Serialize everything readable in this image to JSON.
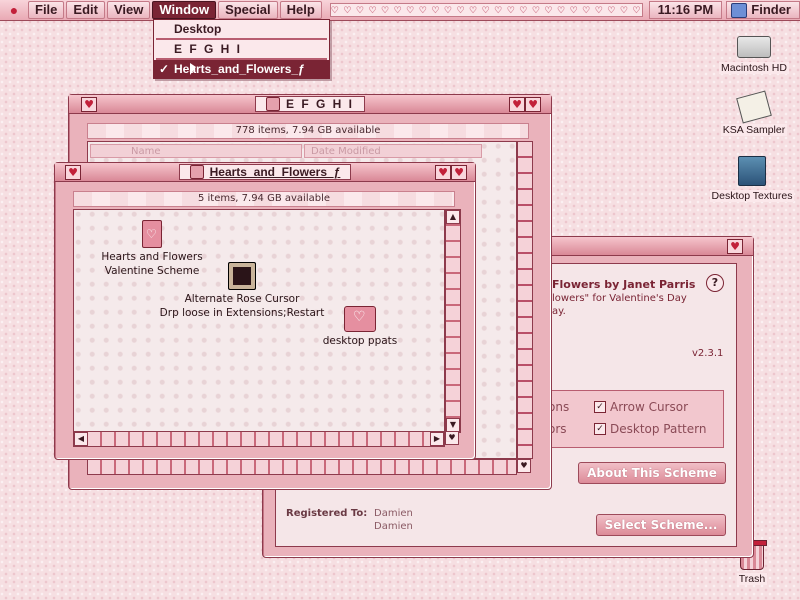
{
  "menubar": {
    "apple_icon": "apple-icon",
    "menus": [
      "File",
      "Edit",
      "View",
      "Window",
      "Special",
      "Help"
    ],
    "active_menu": "Window",
    "hearts": "♡ ♡ ♡ ♡ ♡ ♡ ♡ ♡ ♡ ♡ ♡ ♡ ♡ ♡ ♡ ♡ ♡ ♡ ♡ ♡ ♡ ♡ ♡ ♡ ♡ ♡ ♡ ♡ ♡ ♡",
    "clock": "11:16 PM",
    "app": "Finder"
  },
  "window_menu": {
    "items": [
      {
        "label": "Desktop"
      },
      {
        "label": "E F G H I"
      },
      {
        "label": "Hearts_and_Flowers_ƒ",
        "checked": true
      }
    ],
    "check_mark": "✓"
  },
  "window_efghi": {
    "title": "E F G H I",
    "info": "778 items, 7.94 GB available",
    "columns": [
      "Name",
      "Date Modified"
    ]
  },
  "window_hearts": {
    "title": "Hearts_and_Flowers_ƒ",
    "info": "5 items, 7.94 GB available",
    "icons": [
      {
        "label_line1": "Hearts and Flowers",
        "label_line2": "Valentine Scheme",
        "icon": "scheme-document-icon"
      },
      {
        "label_line1": "Alternate Rose Cursor",
        "label_line2": "Drp loose in Extensions;Restart",
        "icon": "rose-cursor-icon"
      },
      {
        "label_line1": "desktop ppats",
        "label_line2": "",
        "icon": "heart-folder-icon"
      }
    ]
  },
  "scheme_window": {
    "title_part": "Flowers by Janet Parris",
    "subtitle_part": "lowers\" for Valentine's Day",
    "subtitle_part2": "ay.",
    "version": "v2.3.1",
    "option_left1": "ons",
    "option_left2": "ors",
    "option_arrow": "Arrow Cursor",
    "option_pattern": "Desktop Pattern",
    "check_mark": "✓",
    "about_button": "About This Scheme",
    "registered_label": "Registered To:",
    "registered_name1": "Damien",
    "registered_name2": "Damien",
    "select_button": "Select Scheme...",
    "help_glyph": "?"
  },
  "desktop": {
    "icons": [
      {
        "label": "Macintosh HD",
        "icon": "hard-disk-icon"
      },
      {
        "label": "KSA Sampler",
        "icon": "ksa-sampler-icon"
      },
      {
        "label": "Desktop Textures",
        "icon": "desktop-textures-icon"
      },
      {
        "label": "Trash",
        "icon": "trash-icon"
      }
    ]
  },
  "colors": {
    "accent": "#7a2434",
    "window_frame": "#eab2bb",
    "desktop": "#f6dfe2"
  }
}
